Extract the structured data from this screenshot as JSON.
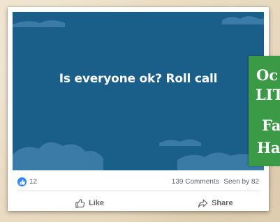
{
  "post": {
    "image_text": "Is everyone ok? Roll call",
    "colors": {
      "image_bg": "#1a5e8a",
      "cloud": "#3e7eab",
      "overlay": "#3a9a46"
    }
  },
  "stats": {
    "like_count": "12",
    "comments": "139 Comments",
    "seen_by": "Seen by 82"
  },
  "actions": {
    "like_label": "Like",
    "share_label": "Share"
  },
  "overlay": {
    "lines": [
      "Oc",
      "LIT",
      "Fa",
      "Ha"
    ]
  },
  "icons": [
    "like-badge-icon",
    "thumbs-up-icon",
    "share-icon"
  ]
}
